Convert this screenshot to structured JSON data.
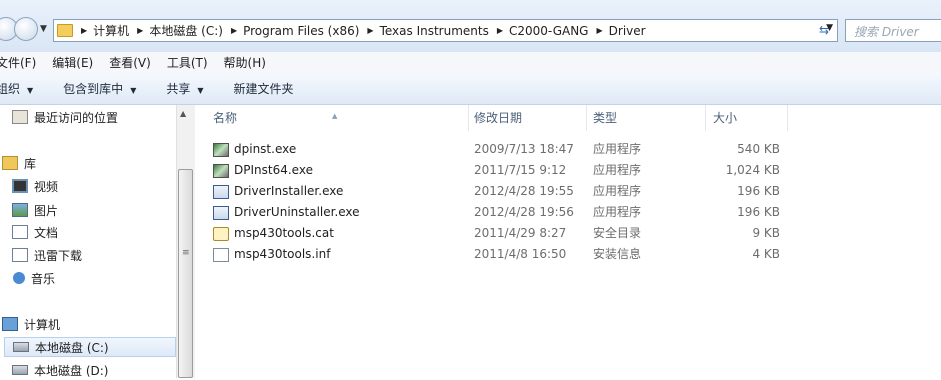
{
  "address": {
    "crumbs": [
      "计算机",
      "本地磁盘 (C:)",
      "Program Files (x86)",
      "Texas Instruments",
      "C2000-GANG",
      "Driver"
    ],
    "search_placeholder": "搜索 Driver"
  },
  "menu": [
    "文件(F)",
    "编辑(E)",
    "查看(V)",
    "工具(T)",
    "帮助(H)"
  ],
  "toolbar": {
    "organize": "组织",
    "include_library": "包含到库中",
    "share": "共享",
    "new_folder": "新建文件夹"
  },
  "nav": {
    "recent": "最近访问的位置",
    "libraries": "库",
    "videos": "视频",
    "pictures": "图片",
    "documents": "文档",
    "thunder": "迅雷下载",
    "music": "音乐",
    "computer": "计算机",
    "disk_c": "本地磁盘 (C:)",
    "disk_d": "本地磁盘 (D:)"
  },
  "columns": {
    "name": "名称",
    "modified": "修改日期",
    "type": "类型",
    "size": "大小"
  },
  "files": [
    {
      "name": "dpinst.exe",
      "modified": "2009/7/13 18:47",
      "type": "应用程序",
      "size": "540 KB",
      "icon": "installer-icon"
    },
    {
      "name": "DPInst64.exe",
      "modified": "2011/7/15 9:12",
      "type": "应用程序",
      "size": "1,024 KB",
      "icon": "installer-icon"
    },
    {
      "name": "DriverInstaller.exe",
      "modified": "2012/4/28 19:55",
      "type": "应用程序",
      "size": "196 KB",
      "icon": "app-icon"
    },
    {
      "name": "DriverUninstaller.exe",
      "modified": "2012/4/28 19:56",
      "type": "应用程序",
      "size": "196 KB",
      "icon": "app-icon"
    },
    {
      "name": "msp430tools.cat",
      "modified": "2011/4/29 8:27",
      "type": "安全目录",
      "size": "9 KB",
      "icon": "catalog-icon"
    },
    {
      "name": "msp430tools.inf",
      "modified": "2011/4/8 16:50",
      "type": "安装信息",
      "size": "4 KB",
      "icon": "inf-file-icon"
    }
  ]
}
